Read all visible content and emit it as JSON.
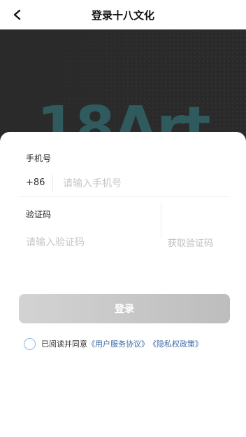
{
  "nav": {
    "title": "登录十八文化",
    "back_icon": "chevron-left-icon"
  },
  "banner": {
    "logo_text": "18Art"
  },
  "form": {
    "phone_label": "手机号",
    "phone_prefix": "+86",
    "phone_placeholder": "请输入手机号",
    "phone_value": "",
    "code_label": "验证码",
    "code_placeholder": "请输入验证码",
    "code_value": "",
    "get_code_label": "获取验证码",
    "login_label": "登录"
  },
  "agreement": {
    "text": "已阅读并同意",
    "user_agreement": "《用户服务协议》",
    "privacy_policy": "《隐私权政策》",
    "checked": false
  },
  "colors": {
    "link": "#3a6aa5",
    "radio_border": "#8fb6e8",
    "banner_bg": "#2a2a2a"
  }
}
